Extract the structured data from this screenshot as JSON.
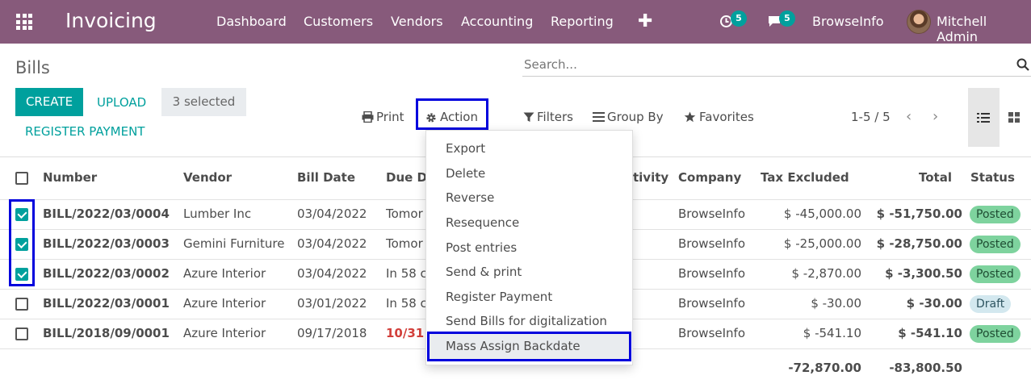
{
  "topbar": {
    "brand": "Invoicing",
    "nav": [
      "Dashboard",
      "Customers",
      "Vendors",
      "Accounting",
      "Reporting"
    ],
    "activities_count": "5",
    "messages_count": "5",
    "company": "BrowseInfo",
    "user": "Mitchell Admin"
  },
  "page": {
    "title": "Bills",
    "search_placeholder": "Search...",
    "create": "CREATE",
    "upload": "UPLOAD",
    "selected": "3 selected",
    "register_payment": "REGISTER PAYMENT",
    "print": "Print",
    "action": "Action",
    "filters": "Filters",
    "group_by": "Group By",
    "favorites": "Favorites",
    "pager": "1-5 / 5"
  },
  "table": {
    "headers": {
      "number": "Number",
      "vendor": "Vendor",
      "bill_date": "Bill Date",
      "due_date": "Due D",
      "activity": "tivity",
      "company": "Company",
      "tax_excluded": "Tax Excluded",
      "total": "Total",
      "status": "Status"
    },
    "rows": [
      {
        "checked": true,
        "number": "BILL/2022/03/0004",
        "vendor": "Lumber Inc",
        "bill_date": "03/04/2022",
        "due": "Tomor",
        "company": "BrowseInfo",
        "tax_excluded": "$ -45,000.00",
        "total": "$ -51,750.00",
        "status": "Posted"
      },
      {
        "checked": true,
        "number": "BILL/2022/03/0003",
        "vendor": "Gemini Furniture",
        "bill_date": "03/04/2022",
        "due": "Tomor",
        "company": "BrowseInfo",
        "tax_excluded": "$ -25,000.00",
        "total": "$ -28,750.00",
        "status": "Posted"
      },
      {
        "checked": true,
        "number": "BILL/2022/03/0002",
        "vendor": "Azure Interior",
        "bill_date": "03/04/2022",
        "due": "In 58 c",
        "company": "BrowseInfo",
        "tax_excluded": "$ -2,870.00",
        "total": "$ -3,300.50",
        "status": "Posted"
      },
      {
        "checked": false,
        "number": "BILL/2022/03/0001",
        "vendor": "Azure Interior",
        "bill_date": "03/01/2022",
        "due": "In 58 c",
        "company": "BrowseInfo",
        "tax_excluded": "$ -30.00",
        "total": "$ -30.00",
        "status": "Draft"
      },
      {
        "checked": false,
        "number": "BILL/2018/09/0001",
        "vendor": "Azure Interior",
        "bill_date": "09/17/2018",
        "due": "10/31",
        "company": "BrowseInfo",
        "tax_excluded": "$ -541.10",
        "total": "$ -541.10",
        "status": "Posted"
      }
    ],
    "footer": {
      "tax_excluded": "-72,870.00",
      "total": "-83,800.50"
    }
  },
  "action_menu": {
    "items": [
      "Export",
      "Delete",
      "Reverse",
      "Resequence",
      "Post entries",
      "Send & print",
      "Register Payment",
      "Send Bills for digitalization",
      "Mass Assign Backdate"
    ]
  },
  "colors": {
    "brand": "#875a7b",
    "accent": "#00a09d",
    "posted": "#7ed39e",
    "draft": "#d3e8ef",
    "highlight": "#0000dd"
  }
}
